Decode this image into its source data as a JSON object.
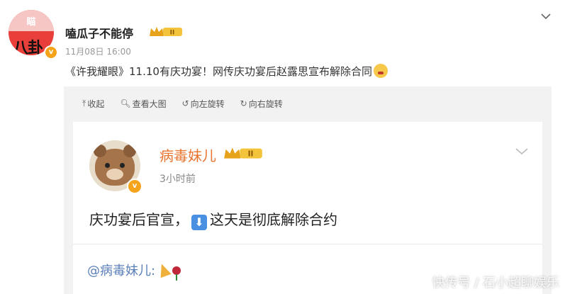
{
  "post": {
    "avatar_top_text": "瞄",
    "avatar_bottom_text": "八卦",
    "author": "嗑瓜子不能停",
    "level_badge": "II",
    "timestamp": "11月08日 16:00",
    "text": "《许我耀眼》11.10有庆功宴！网传庆功宴后赵露思宣布解除合同"
  },
  "toolbar": {
    "collapse": "收起",
    "view_large": "查看大图",
    "rotate_left": "向左旋转",
    "rotate_right": "向右旋转"
  },
  "card": {
    "name": "病毒妹儿",
    "level_badge": "II",
    "time": "3小时前",
    "text_before": "庆功宴后官宣，",
    "text_after": "这天是彻底解除合约",
    "mention": "@病毒妹儿:"
  },
  "watermark": "快传号 / 石小超聊娱乐",
  "colors": {
    "accent_orange": "#e8742f",
    "verified_yellow": "#f4a31a",
    "link_blue": "#5a7fb8"
  }
}
